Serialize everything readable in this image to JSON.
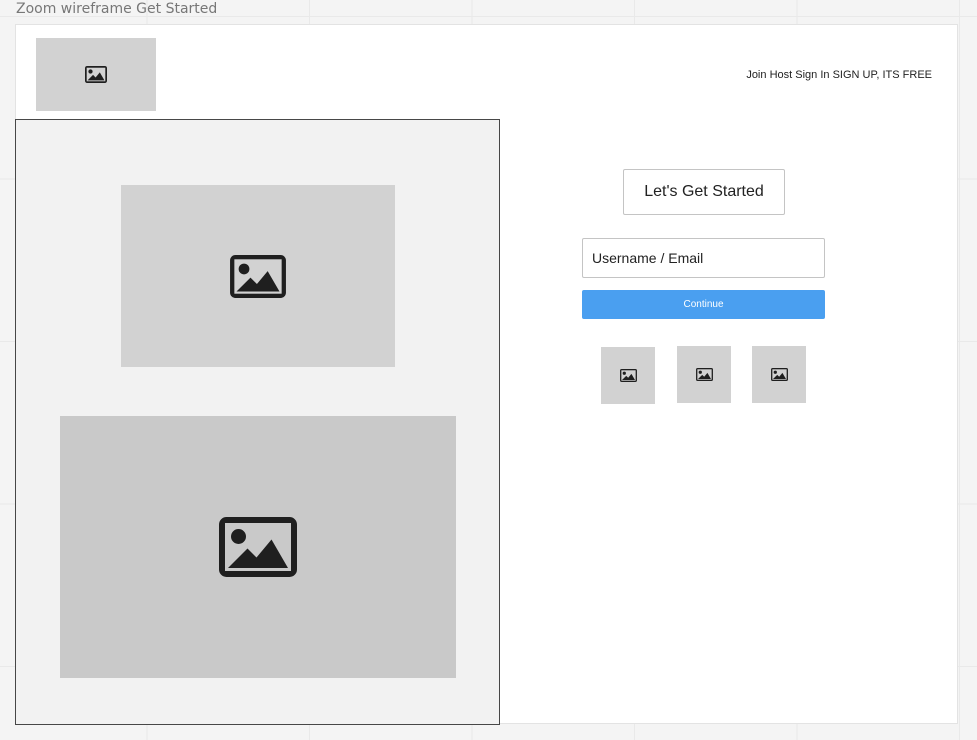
{
  "frame": {
    "title": "Zoom wireframe Get Started"
  },
  "header": {
    "logo_icon": "image-icon",
    "nav": {
      "join": "Join",
      "host": "Host",
      "sign_in": "Sign In",
      "sign_up": "SIGN UP, ITS FREE"
    }
  },
  "left_panel": {
    "top_image_icon": "image-icon",
    "bottom_image_icon": "image-icon"
  },
  "form": {
    "heading": "Let's Get Started",
    "username": {
      "placeholder": "Username / Email",
      "value": ""
    },
    "continue_label": "Continue",
    "social_icons": [
      "image-icon",
      "image-icon",
      "image-icon"
    ]
  },
  "colors": {
    "primary_button": "#4a9ff0",
    "placeholder_fill": "#d2d2d2",
    "panel_background": "#f2f2f2",
    "canvas_background": "#f4f4f4"
  }
}
